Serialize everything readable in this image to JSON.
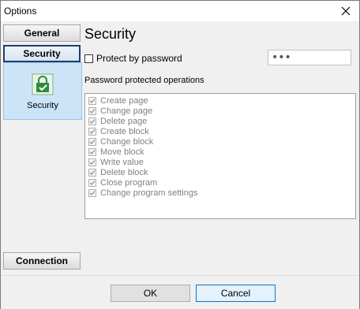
{
  "window": {
    "title": "Options"
  },
  "sidebar": {
    "general_label": "General",
    "security_label": "Security",
    "security_panel_label": "Security",
    "connection_label": "Connection"
  },
  "content": {
    "title": "Security",
    "protect_label": "Protect by password",
    "protect_checked": false,
    "password_value": "•••",
    "ops_heading": "Password protected operations",
    "operations": [
      {
        "label": "Create page",
        "checked": true
      },
      {
        "label": "Change page",
        "checked": true
      },
      {
        "label": "Delete page",
        "checked": true
      },
      {
        "label": "Create block",
        "checked": true
      },
      {
        "label": "Change block",
        "checked": true
      },
      {
        "label": "Move block",
        "checked": true
      },
      {
        "label": "Write value",
        "checked": true
      },
      {
        "label": "Delete block",
        "checked": true
      },
      {
        "label": "Close program",
        "checked": true
      },
      {
        "label": "Change program settings",
        "checked": true
      }
    ]
  },
  "footer": {
    "ok_label": "OK",
    "cancel_label": "Cancel"
  },
  "colors": {
    "selected_panel": "#cce4f7",
    "shield_green": "#2e8b3a",
    "cancel_border": "#0078d7"
  }
}
